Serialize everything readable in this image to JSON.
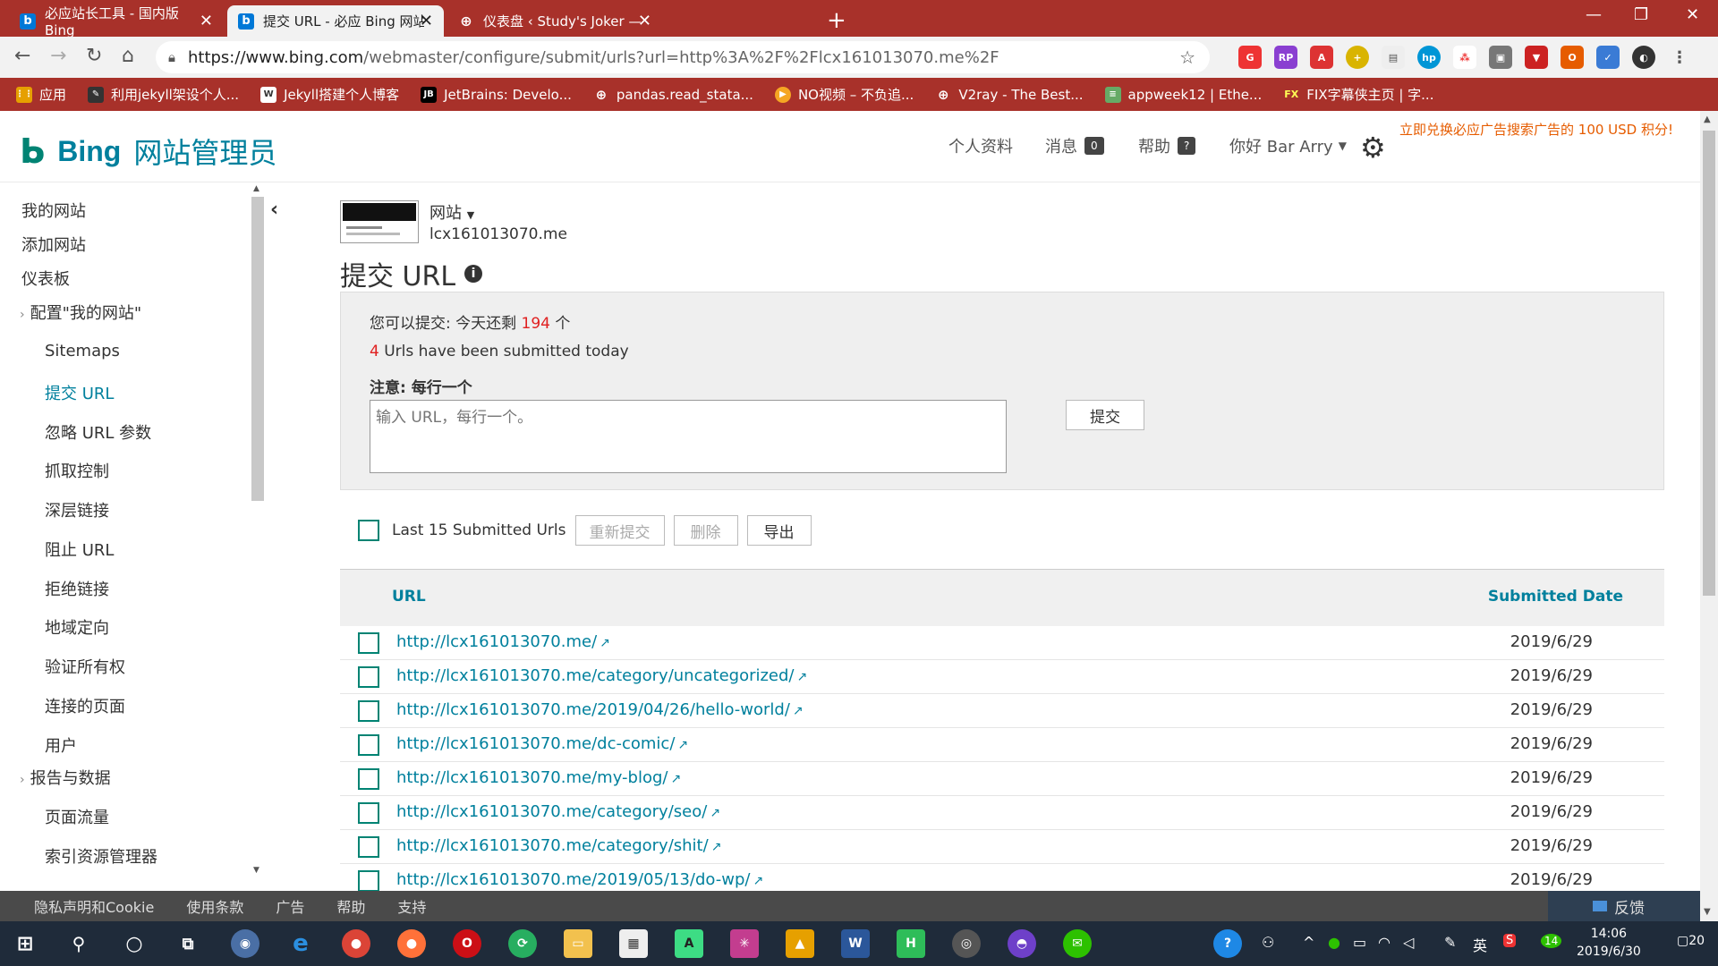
{
  "browser": {
    "tabs": [
      {
        "title": "必应站长工具 - 国内版 Bing",
        "active": false
      },
      {
        "title": "提交 URL - 必应 Bing 网站管理员",
        "active": true
      },
      {
        "title": "仪表盘 ‹ Study's Joker — Word",
        "active": false
      }
    ],
    "url_host": "https://www.bing.com",
    "url_rest": "/webmaster/configure/submit/urls?url=http%3A%2F%2Flcx161013070.me%2F",
    "bookmarks": [
      {
        "label": "应用",
        "icon": "apps-icon"
      },
      {
        "label": "利用jekyll架设个人...",
        "icon": "jekyll-icon"
      },
      {
        "label": "Jekyll搭建个人博客",
        "icon": "w-icon"
      },
      {
        "label": "JetBrains: Develo...",
        "icon": "jetbrains-icon"
      },
      {
        "label": "pandas.read_stata...",
        "icon": "globe-icon"
      },
      {
        "label": "NO视频 – 不负追...",
        "icon": "play-icon"
      },
      {
        "label": "V2ray - The Best...",
        "icon": "globe-icon"
      },
      {
        "label": "appweek12 | Ethe...",
        "icon": "ethereum-icon"
      },
      {
        "label": "FIX字幕侠主页 | 字...",
        "icon": "fix-icon"
      }
    ]
  },
  "header": {
    "brand": "Bing",
    "product": "网站管理员",
    "nav_profile": "个人资料",
    "nav_messages": "消息",
    "messages_count": "0",
    "nav_help": "帮助",
    "help_badge": "?",
    "greeting": "你好 Bar Arry",
    "promo": "立即兑换必应广告搜索广告的 100 USD 积分!"
  },
  "sidebar": {
    "items": [
      {
        "label": "我的网站"
      },
      {
        "label": "添加网站"
      },
      {
        "label": "仪表板"
      },
      {
        "label": "配置\"我的网站\""
      },
      {
        "label": "Sitemaps"
      },
      {
        "label": "提交 URL"
      },
      {
        "label": "忽略 URL 参数"
      },
      {
        "label": "抓取控制"
      },
      {
        "label": "深层链接"
      },
      {
        "label": "阻止 URL"
      },
      {
        "label": "拒绝链接"
      },
      {
        "label": "地域定向"
      },
      {
        "label": "验证所有权"
      },
      {
        "label": "连接的页面"
      },
      {
        "label": "用户"
      },
      {
        "label": "报告与数据"
      },
      {
        "label": "页面流量"
      },
      {
        "label": "索引资源管理器"
      }
    ]
  },
  "site": {
    "label": "网站",
    "domain": "lcx161013070.me"
  },
  "page": {
    "title": "提交 URL",
    "quota_prefix": "您可以提交: 今天还剩",
    "quota_remaining": "194",
    "quota_suffix": "个",
    "submitted_count": "4",
    "submitted_text": "Urls have been submitted today",
    "note": "注意: 每行一个",
    "textarea_placeholder": "输入 URL，每行一个。",
    "submit_label": "提交",
    "last_label": "Last 15 Submitted Urls",
    "resubmit_label": "重新提交",
    "delete_label": "删除",
    "export_label": "导出"
  },
  "table": {
    "col_url": "URL",
    "col_date": "Submitted Date",
    "rows": [
      {
        "url": "http://lcx161013070.me/",
        "date": "2019/6/29"
      },
      {
        "url": "http://lcx161013070.me/category/uncategorized/",
        "date": "2019/6/29"
      },
      {
        "url": "http://lcx161013070.me/2019/04/26/hello-world/",
        "date": "2019/6/29"
      },
      {
        "url": "http://lcx161013070.me/dc-comic/",
        "date": "2019/6/29"
      },
      {
        "url": "http://lcx161013070.me/my-blog/",
        "date": "2019/6/29"
      },
      {
        "url": "http://lcx161013070.me/category/seo/",
        "date": "2019/6/29"
      },
      {
        "url": "http://lcx161013070.me/category/shit/",
        "date": "2019/6/29"
      },
      {
        "url": "http://lcx161013070.me/2019/05/13/do-wp/",
        "date": "2019/6/29"
      }
    ]
  },
  "footer": {
    "links": [
      "隐私声明和Cookie",
      "使用条款",
      "广告",
      "帮助",
      "支持"
    ],
    "feedback": "反馈"
  },
  "taskbar": {
    "ime": "英",
    "badge": "14",
    "time": "14:06",
    "date": "2019/6/30",
    "notifications": "20"
  },
  "colors": {
    "chrome_red": "#a8312a",
    "bing_teal": "#008373",
    "link_blue": "#00809d",
    "quota_red": "#e02020"
  }
}
